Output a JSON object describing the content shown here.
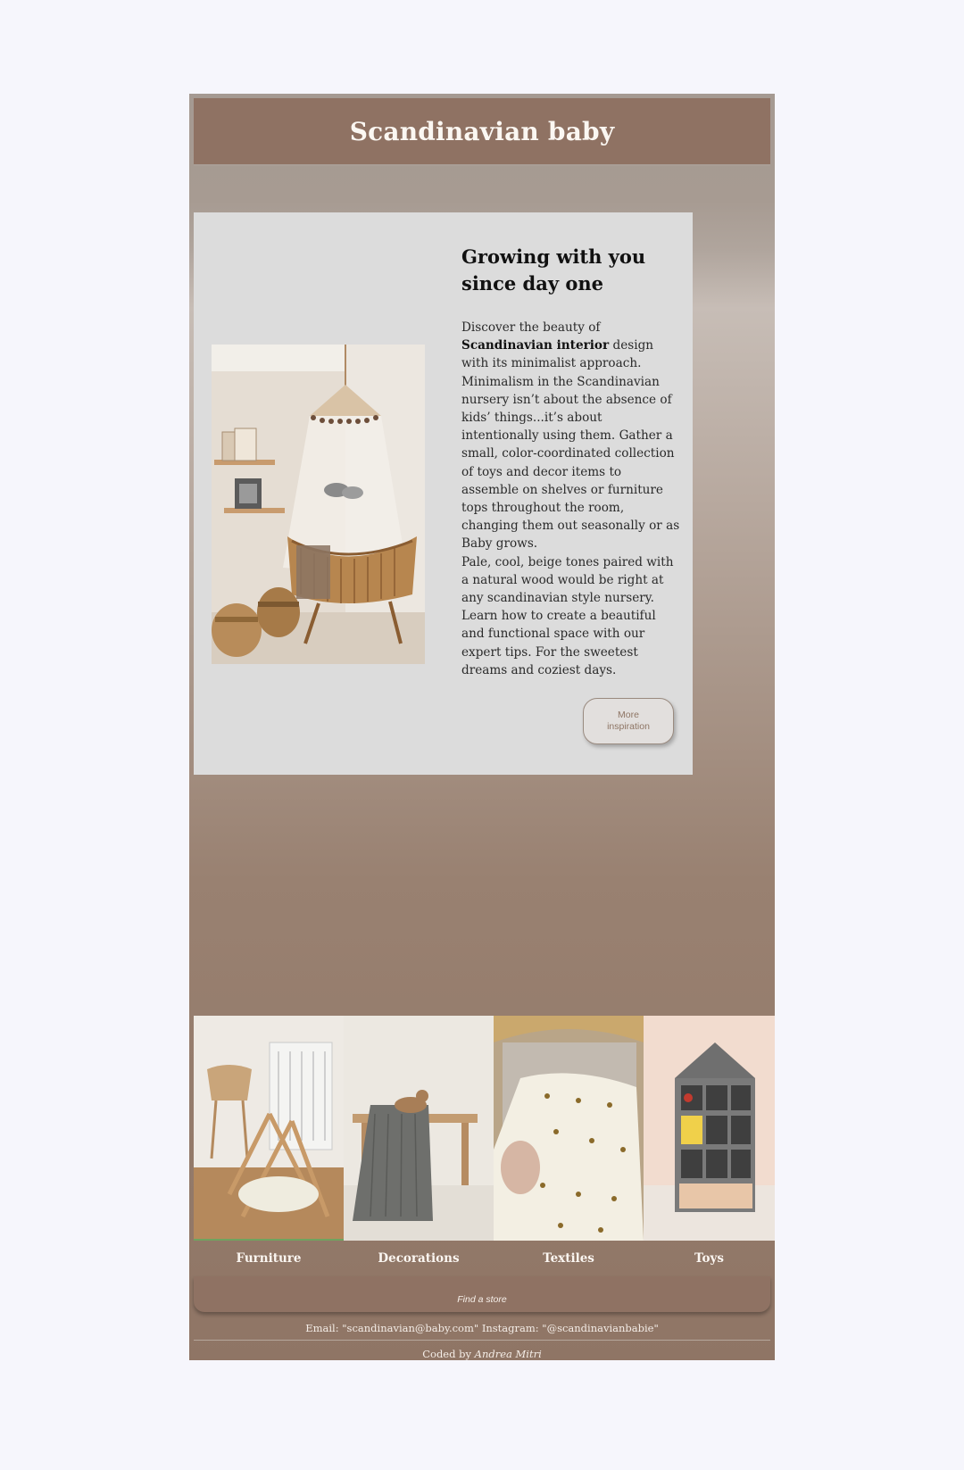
{
  "header": {
    "title": "Scandinavian baby"
  },
  "feature": {
    "heading": "Growing with you since day one",
    "intro_before": "Discover the beauty of ",
    "intro_bold": "Scandinavian interior",
    "intro_after": " design with its minimalist approach. Minimalism in the Scandinavian nursery isn’t about the absence of kids’ things...it’s about intentionally using them. Gather a small, color-coordinated collection of toys and decor items to assemble on shelves or furniture tops throughout the room, changing them out seasonally or as Baby grows.",
    "paragraph_2": "Pale, cool, beige tones paired with a natural wood would be right at any scandinavian style nursery.",
    "paragraph_3": "Learn how to create a beautiful and functional space with our expert tips. For the sweetest dreams and coziest days.",
    "button_label": "More inspiration"
  },
  "categories": [
    {
      "label": "Furniture"
    },
    {
      "label": "Decorations"
    },
    {
      "label": "Textiles"
    },
    {
      "label": "Toys"
    }
  ],
  "footer": {
    "store_link": "Find a store",
    "contact": "Email: \"scandinavian@baby.com\" Instagram: \"@scandinavianbabie\"",
    "credit_prefix": "Coded by ",
    "credit_name": "Andrea Mitri"
  },
  "colors": {
    "brown": "#8f7263",
    "card": "#dcdcdc",
    "background": "#f6f6fc"
  }
}
